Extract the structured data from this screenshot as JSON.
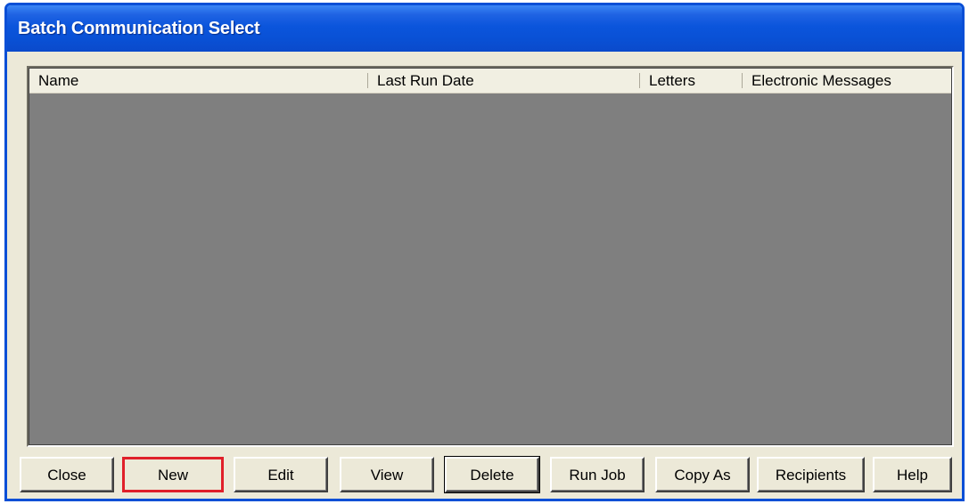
{
  "window": {
    "title": "Batch Communication Select"
  },
  "list": {
    "columns": [
      "Name",
      "Last Run Date",
      "Letters",
      "Electronic Messages"
    ],
    "rows": []
  },
  "buttons": {
    "close": "Close",
    "new": "New",
    "edit": "Edit",
    "view": "View",
    "delete": "Delete",
    "run_job": "Run Job",
    "copy_as": "Copy As",
    "recipients": "Recipients",
    "help": "Help"
  },
  "colors": {
    "titlebar": "#0a4fd6",
    "dialog_background": "#ece9d8",
    "list_background": "#7f7f7f",
    "highlight_border": "#e0202a"
  }
}
